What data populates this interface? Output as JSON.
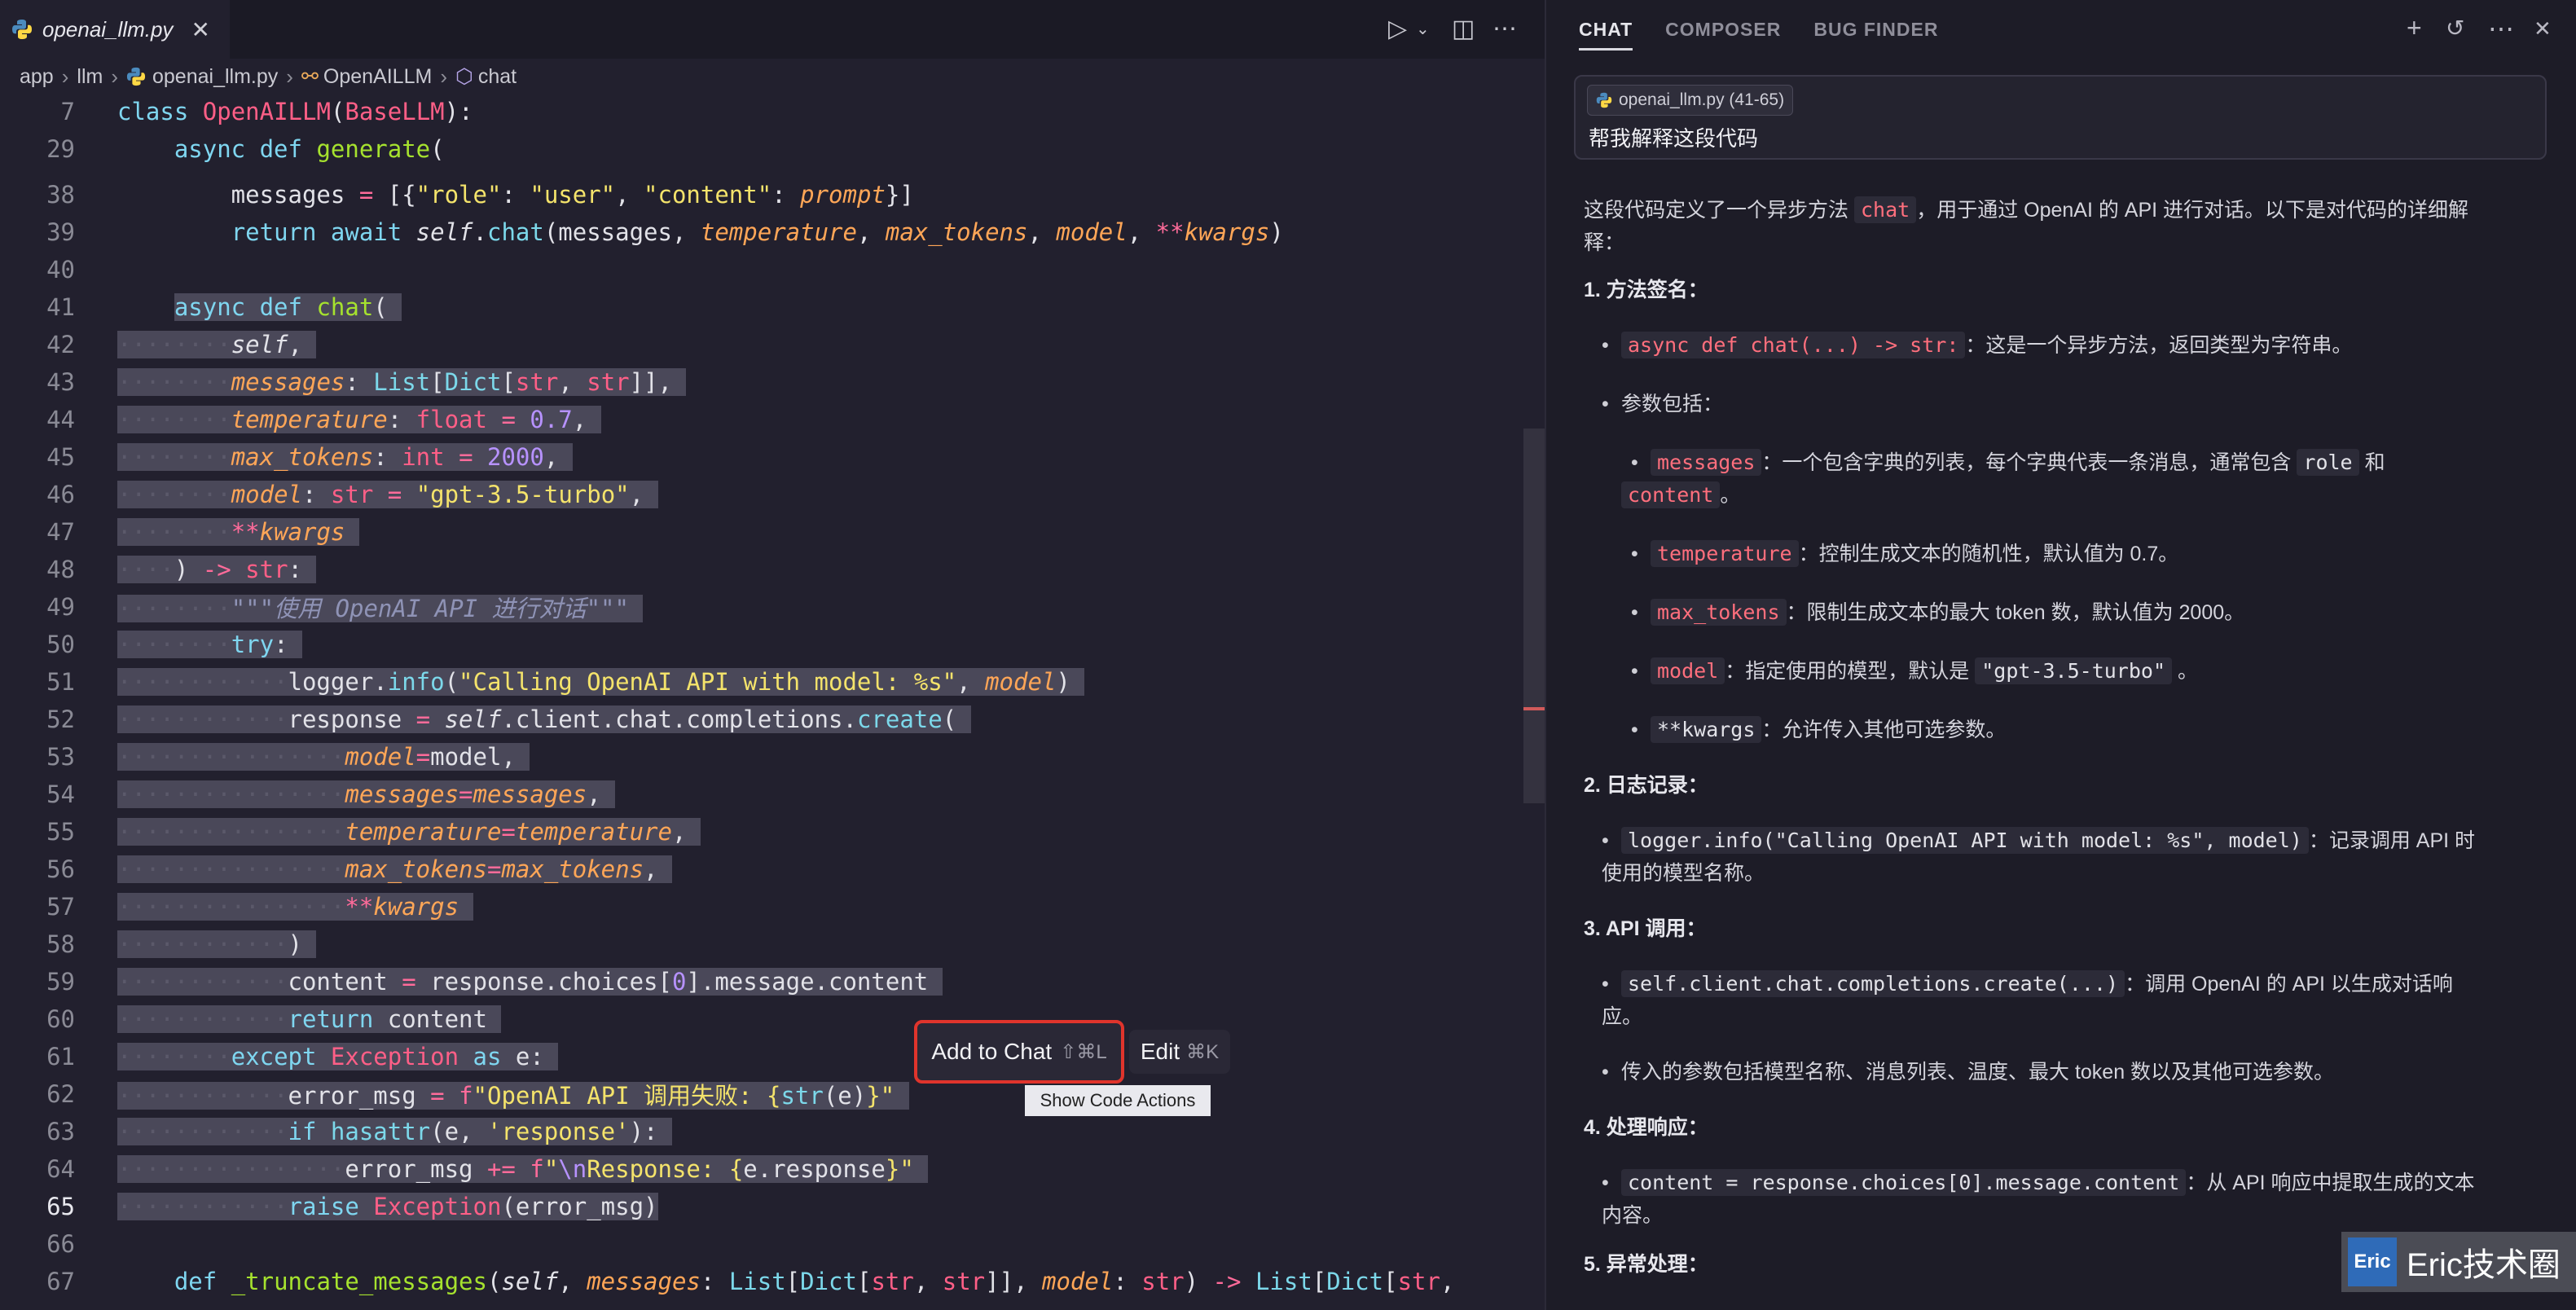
{
  "editor": {
    "tab": {
      "filename": "openai_llm.py"
    },
    "breadcrumb": {
      "app": "app",
      "llm": "llm",
      "file": "openai_llm.py",
      "class": "OpenAILLM",
      "method": "chat"
    },
    "lines": {
      "l7": "7",
      "l29": "29",
      "l38": "38",
      "l39": "39",
      "l40": "40",
      "l41": "41",
      "l42": "42",
      "l43": "43",
      "l44": "44",
      "l45": "45",
      "l46": "46",
      "l47": "47",
      "l48": "48",
      "l49": "49",
      "l50": "50",
      "l51": "51",
      "l52": "52",
      "l53": "53",
      "l54": "54",
      "l55": "55",
      "l56": "56",
      "l57": "57",
      "l58": "58",
      "l59": "59",
      "l60": "60",
      "l61": "61",
      "l62": "62",
      "l63": "63",
      "l64": "64",
      "l65": "65",
      "l66": "66",
      "l67": "67"
    }
  },
  "floating": {
    "add_to_chat": "Add to Chat",
    "add_to_chat_shortcut": "⇧⌘L",
    "edit": "Edit",
    "edit_shortcut": "⌘K",
    "show_code_actions": "Show Code Actions"
  },
  "chat": {
    "tabs": [
      "CHAT",
      "COMPOSER",
      "BUG FINDER"
    ],
    "context_chip": "openai_llm.py (41-65)",
    "prompt": "帮我解释这段代码",
    "answer": {
      "intro_a": "这段代码定义了一个异步方法",
      "intro_code": "chat",
      "intro_b": "，用于通过 OpenAI 的 API 进行对话。以下是对代码的详细解",
      "intro_c": "释：",
      "s1": "1. 方法签名：",
      "s1_code": "async def chat(...) -> str:",
      "s1_desc": "：这是一个异步方法，返回类型为字符串。",
      "s1_params": "参数包括：",
      "p1_code": "messages",
      "p1_desc": "：一个包含字典的列表，每个字典代表一条消息，通常包含",
      "p1_role": "role",
      "p1_and": "和",
      "p1_content": "content",
      "p1_end": "。",
      "p2_code": "temperature",
      "p2_desc": "：控制生成文本的随机性，默认值为 0.7。",
      "p3_code": "max_tokens",
      "p3_desc": "：限制生成文本的最大 token 数，默认值为 2000。",
      "p4_code": "model",
      "p4_desc": "：指定使用的模型，默认是",
      "p4_val": "\"gpt-3.5-turbo\"",
      "p4_end": "。",
      "p5_code": "**kwargs",
      "p5_desc": "：允许传入其他可选参数。",
      "s2": "2. 日志记录：",
      "s2_code": "logger.info(\"Calling OpenAI API with model: %s\", model)",
      "s2_desc": "：记录调用 API 时",
      "s2_desc2": "使用的模型名称。",
      "s3": "3. API 调用：",
      "s3_code": "self.client.chat.completions.create(...)",
      "s3_desc": "：调用 OpenAI 的 API 以生成对话响",
      "s3_desc2": "应。",
      "s3_item2": "传入的参数包括模型名称、消息列表、温度、最大 token 数以及其他可选参数。",
      "s4": "4. 处理响应：",
      "s4_code": "content = response.choices[0].message.content",
      "s4_desc": "：从 API 响应中提取生成的文本",
      "s4_desc2": "内容。",
      "s5": "5. 异常处理："
    }
  },
  "watermark": {
    "logo": "Eric",
    "text": "Eric技术圈"
  }
}
